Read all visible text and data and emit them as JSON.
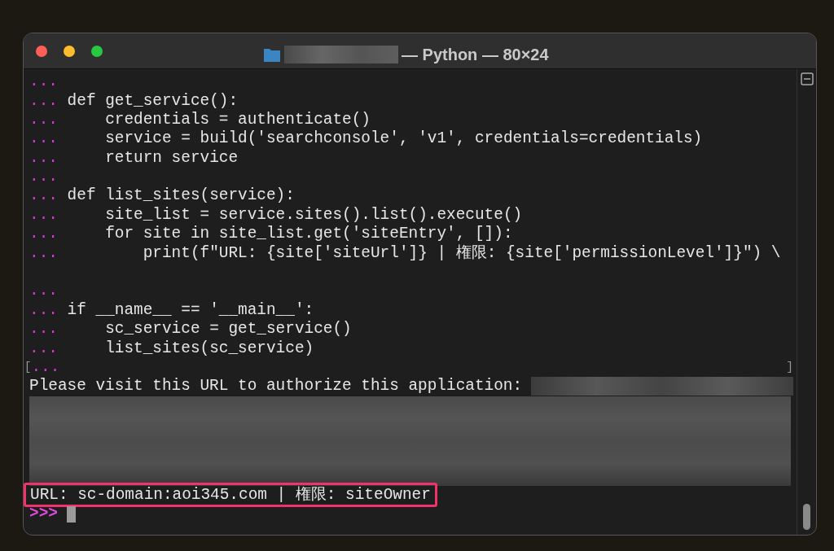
{
  "window": {
    "title": "— Python — 80×24"
  },
  "lines": [
    {
      "kind": "code",
      "prompt": "..."
    },
    {
      "kind": "code",
      "prompt": "...",
      "text": "def get_service():"
    },
    {
      "kind": "code",
      "prompt": "...",
      "text": "    credentials = authenticate()"
    },
    {
      "kind": "code",
      "prompt": "...",
      "text": "    service = build('searchconsole', 'v1', credentials=credentials)"
    },
    {
      "kind": "code",
      "prompt": "...",
      "text": "    return service"
    },
    {
      "kind": "code",
      "prompt": "..."
    },
    {
      "kind": "code",
      "prompt": "...",
      "text": "def list_sites(service):"
    },
    {
      "kind": "code",
      "prompt": "...",
      "text": "    site_list = service.sites().list().execute()"
    },
    {
      "kind": "code",
      "prompt": "...",
      "text": "    for site in site_list.get('siteEntry', []):"
    },
    {
      "kind": "code",
      "prompt": "...",
      "text": "        print(f\"URL: {site['siteUrl']} | 権限: {site['permissionLevel']}\") \\"
    },
    {
      "kind": "blank"
    },
    {
      "kind": "code",
      "prompt": "..."
    },
    {
      "kind": "code",
      "prompt": "...",
      "text": "if __name__ == '__main__':"
    },
    {
      "kind": "code",
      "prompt": "...",
      "text": "    sc_service = get_service()"
    },
    {
      "kind": "code",
      "prompt": "...",
      "text": "    list_sites(sc_service)"
    },
    {
      "kind": "bracketed",
      "prompt": "...",
      "left": "[",
      "right": "]"
    },
    {
      "kind": "output",
      "text": "Please visit this URL to authorize this application:",
      "redacted_tail": true
    },
    {
      "kind": "redacted"
    },
    {
      "kind": "highlighted",
      "text": "URL: sc-domain:aoi345.com | 権限: siteOwner"
    },
    {
      "kind": "input",
      "prompt": ">>>"
    }
  ]
}
